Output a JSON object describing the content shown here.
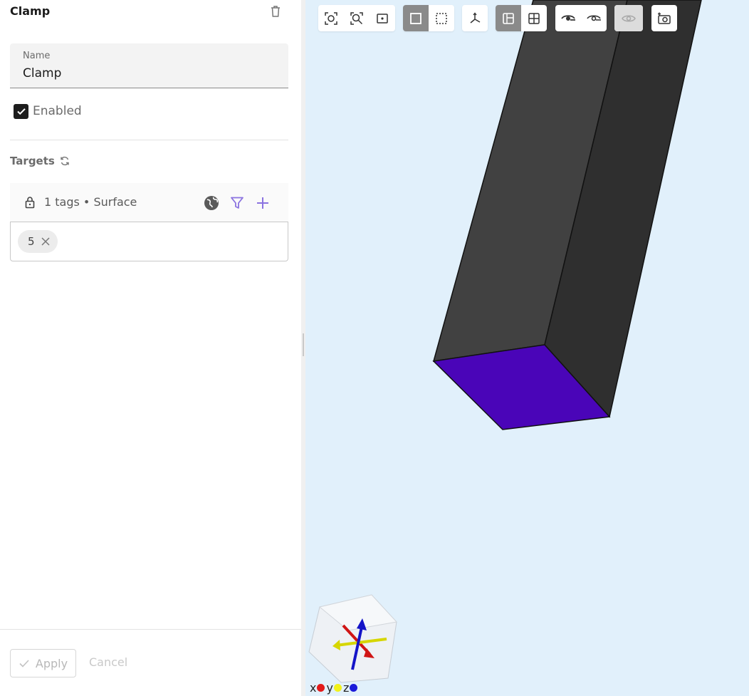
{
  "panel": {
    "title": "Clamp",
    "name_field": {
      "label": "Name",
      "value": "Clamp"
    },
    "enabled": {
      "label": "Enabled",
      "checked": true
    },
    "targets": {
      "label": "Targets",
      "summary": "1 tags • Surface",
      "chips": [
        {
          "label": "5"
        }
      ]
    },
    "footer": {
      "apply_label": "Apply",
      "cancel_label": "Cancel"
    }
  },
  "toolbar": {
    "groups": [
      [
        "focus-selection-icon",
        "zoom-fit-icon",
        "center-view-icon"
      ],
      [
        "select-solid-icon",
        "select-box-icon"
      ],
      [
        "axes-orientation-icon"
      ],
      [
        "single-view-icon",
        "quad-view-icon"
      ],
      [
        "show-icon",
        "hide-icon"
      ],
      [
        "hidden-toggle-icon"
      ],
      [
        "screenshot-icon"
      ]
    ]
  },
  "axes_legend": [
    {
      "label": "x",
      "color": "#e31a1a"
    },
    {
      "label": "y",
      "color": "#f2f21a"
    },
    {
      "label": "z",
      "color": "#1a1ad9"
    }
  ],
  "colors": {
    "viewport_bg": "#e1f0fb",
    "body_front": "#414141",
    "body_side": "#2f2f2f",
    "selected_face": "#4a05b8",
    "accent": "#8b73e0"
  }
}
